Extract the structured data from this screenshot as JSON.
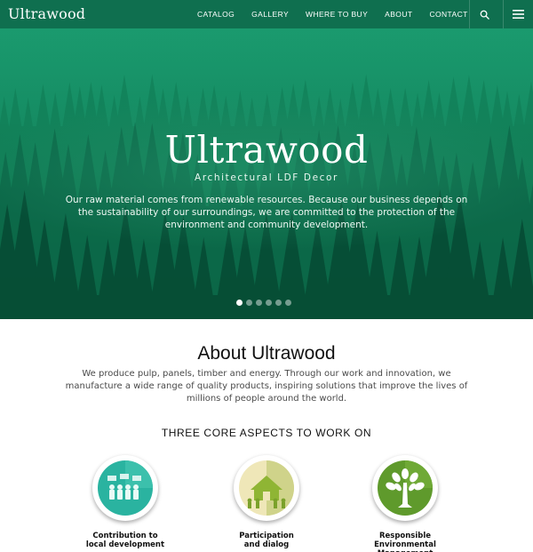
{
  "nav": {
    "logo": "Ultrawood",
    "items": [
      "CATALOG",
      "GALLERY",
      "WHERE TO BUY",
      "ABOUT",
      "CONTACT"
    ],
    "search_icon": "search-icon",
    "menu_icon": "hamburger-menu-icon"
  },
  "hero": {
    "title": "Ultrawood",
    "subtitle": "Architectural LDF Decor",
    "text": "Our raw material comes from renewable resources. Because our business depends on the sustainability of our surroundings, we are committed to the protection of the environment and community development.",
    "slides": 6,
    "active_slide": 1
  },
  "about": {
    "title": "About Ultrawood",
    "text": "We produce pulp, panels, timber and energy. Through our work and innovation, we manufacture a wide range of quality products, inspiring solutions that improve the lives of millions of people around the world."
  },
  "aspects": {
    "title": "THREE CORE ASPECTS TO WORK ON",
    "items": [
      {
        "label_line1": "Contribution to",
        "label_line2": "local development",
        "icon": "people-community-icon",
        "color": "#2ab3a0"
      },
      {
        "label_line1": "Participation",
        "label_line2": "and dialog",
        "icon": "house-people-icon",
        "color": "#b5c84a"
      },
      {
        "label_line1": "Responsible",
        "label_line2": "Environmental Management",
        "icon": "tree-icon",
        "color": "#5f9a2c"
      }
    ]
  },
  "colors": {
    "nav_bg": "#0f6f4f",
    "hero_bg": "#138a61"
  }
}
